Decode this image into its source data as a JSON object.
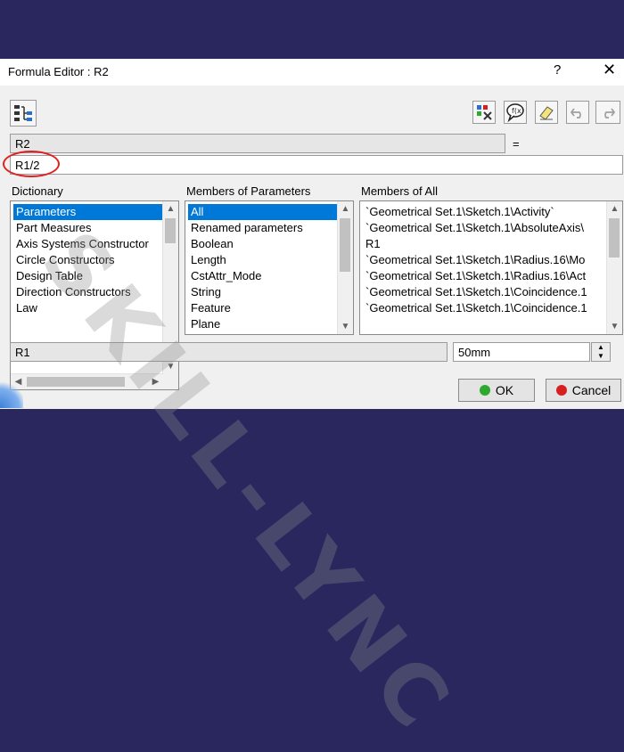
{
  "window": {
    "title": "Formula Editor : R2",
    "help_label": "?",
    "close_label": "✕"
  },
  "toolbar": {
    "left_icon": "formula-tree-icon",
    "right_icons": [
      "dictionary-wizard-icon",
      "speech-bubble-icon",
      "eraser-icon",
      "undo-icon",
      "redo-icon"
    ]
  },
  "parameter": {
    "name": "R2",
    "equals": "=",
    "formula": "R1/2"
  },
  "dictionary": {
    "label": "Dictionary",
    "items": [
      "Parameters",
      "Part Measures",
      "Axis Systems Constructor",
      "Circle Constructors",
      "Design Table",
      "Direction Constructors",
      "Law"
    ],
    "selected": "Parameters"
  },
  "members_of_parameters": {
    "label": "Members of Parameters",
    "items": [
      "All",
      "Renamed parameters",
      "Boolean",
      "Length",
      "CstAttr_Mode",
      "String",
      "Feature",
      "Plane"
    ],
    "selected": "All"
  },
  "members_of_all": {
    "label": "Members of All",
    "items": [
      "`Geometrical Set.1\\Sketch.1\\Activity`",
      "`Geometrical Set.1\\Sketch.1\\AbsoluteAxis\\",
      "R1",
      "`Geometrical Set.1\\Sketch.1\\Radius.16\\Mo",
      "`Geometrical Set.1\\Sketch.1\\Radius.16\\Act",
      "`Geometrical Set.1\\Sketch.1\\Coincidence.1",
      "`Geometrical Set.1\\Sketch.1\\Coincidence.1"
    ]
  },
  "selection": {
    "name": "R1",
    "value": "50mm"
  },
  "buttons": {
    "ok": "OK",
    "cancel": "Cancel"
  },
  "watermark": "SKILL-LYNC",
  "colors": {
    "background": "#29275d",
    "dialog": "#f0f0f0",
    "selection": "#0078d7",
    "ok_led": "#2ea82e",
    "cancel_led": "#d62020",
    "annotation": "#e02020"
  }
}
